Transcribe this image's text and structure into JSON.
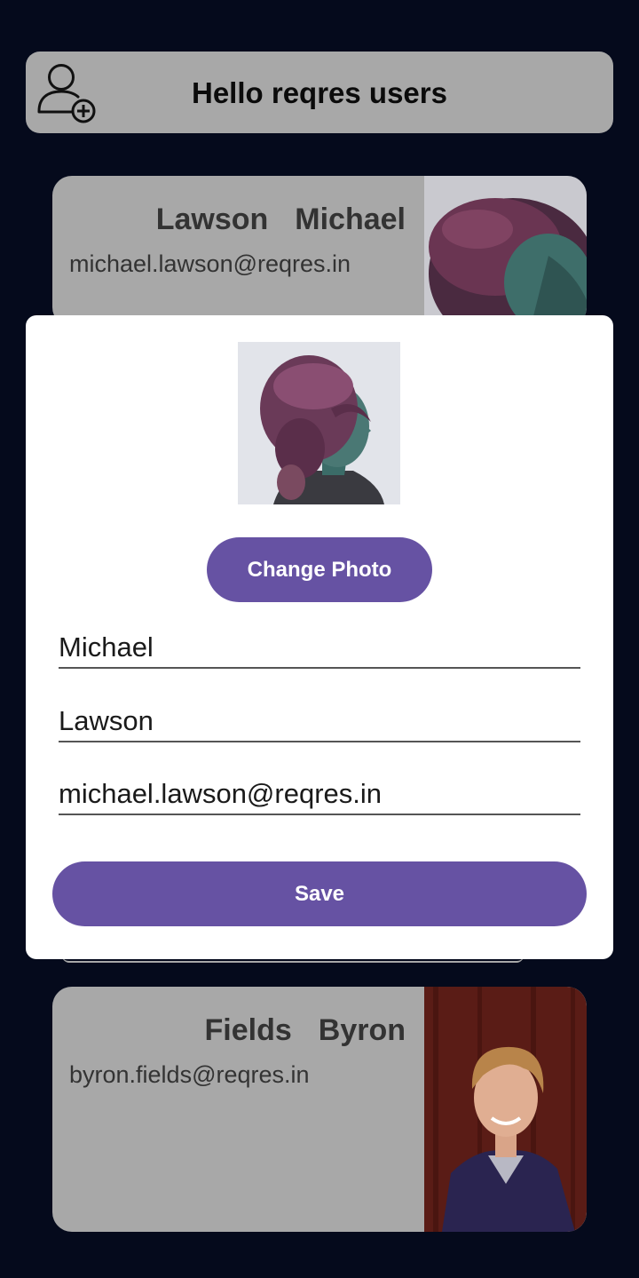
{
  "header": {
    "title": "Hello reqres users",
    "add_user_icon": "add-user-icon"
  },
  "users": [
    {
      "last_name": "Lawson",
      "first_name": "Michael",
      "email": "michael.lawson@reqres.in"
    },
    {
      "last_name": "Fields",
      "first_name": "Byron",
      "email": "byron.fields@reqres.in"
    }
  ],
  "dialog": {
    "change_photo_label": "Change Photo",
    "first_name_value": "Michael",
    "last_name_value": "Lawson",
    "email_value": "michael.lawson@reqres.in",
    "save_label": "Save"
  },
  "colors": {
    "background": "#050a1c",
    "card": "#a8a8a8",
    "accent": "#6652a3",
    "dialog": "#ffffff"
  }
}
